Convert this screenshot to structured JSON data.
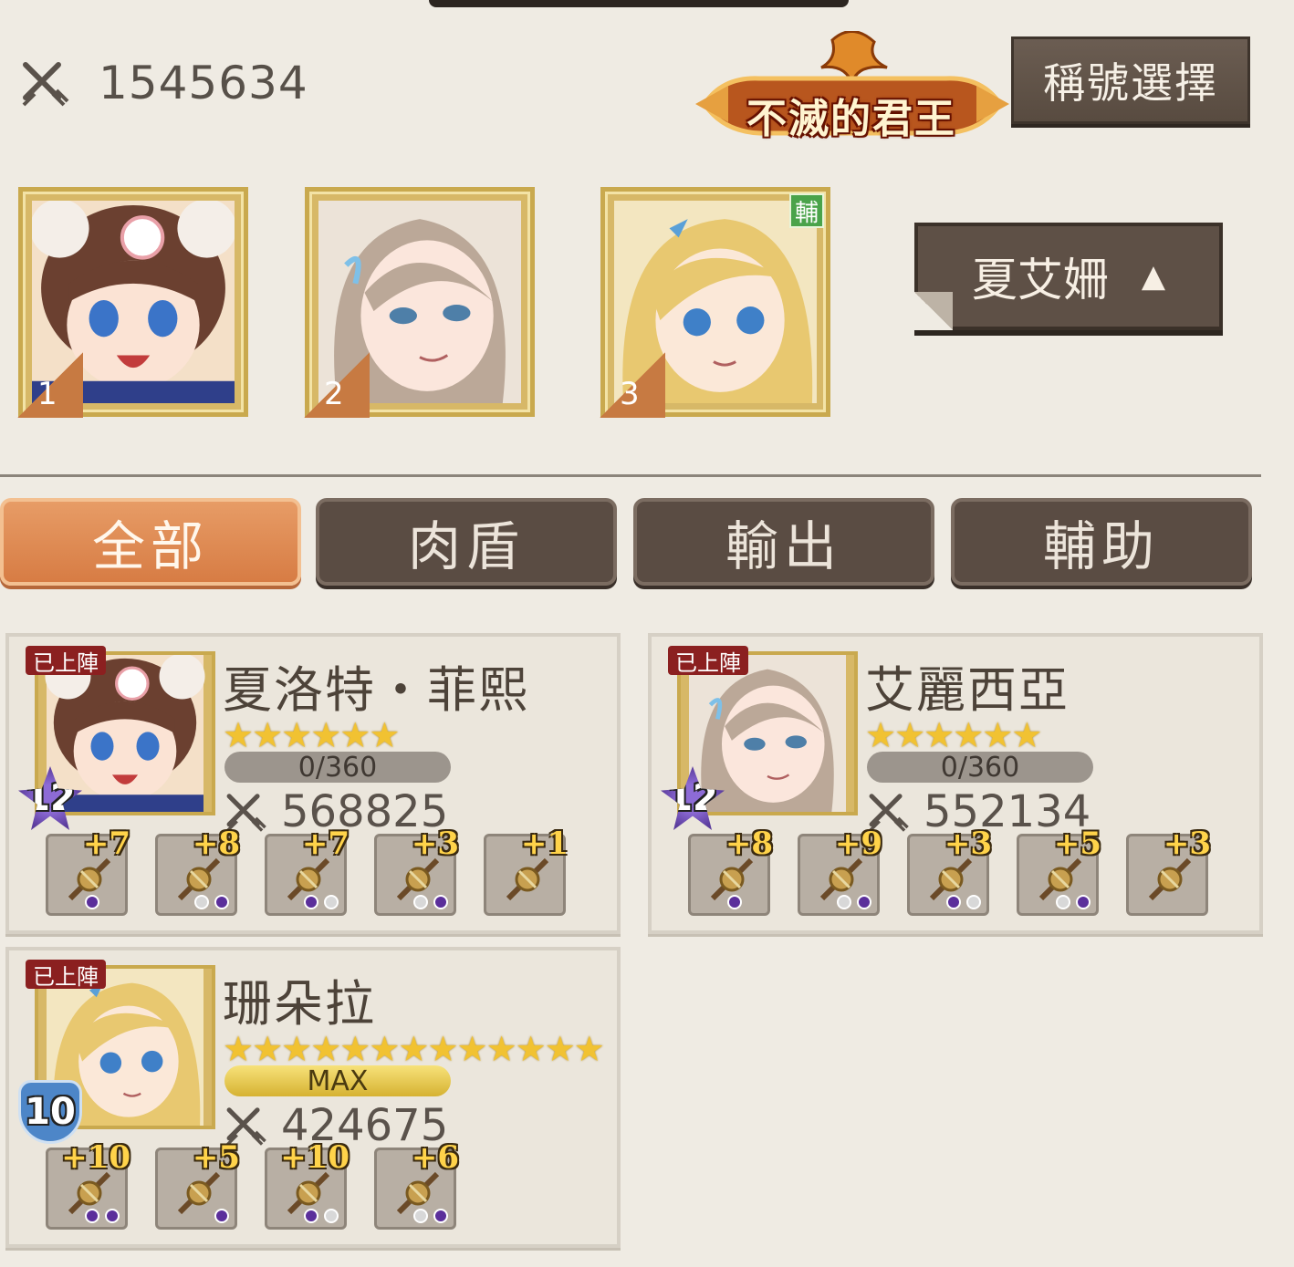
{
  "header": {
    "total_power": "1545634",
    "title_badge": "不滅的君王",
    "title_select_label": "稱號選擇"
  },
  "team": {
    "slots": [
      {
        "number": "1",
        "support": ""
      },
      {
        "number": "2",
        "support": ""
      },
      {
        "number": "3",
        "support": "輔"
      }
    ],
    "leader_select": {
      "name": "夏艾姍",
      "arrow": "▲"
    }
  },
  "tabs": [
    {
      "label": "全部",
      "active": true
    },
    {
      "label": "肉盾",
      "active": false
    },
    {
      "label": "輸出",
      "active": false
    },
    {
      "label": "輔助",
      "active": false
    }
  ],
  "heroes": [
    {
      "deployed_label": "已上陣",
      "name": "夏洛特・菲熙",
      "stars": "★★★★★★",
      "exp": "0/360",
      "level": "12",
      "power": "568825",
      "equipment": [
        "+7",
        "+8",
        "+7",
        "+3",
        "+1"
      ]
    },
    {
      "deployed_label": "已上陣",
      "name": "艾麗西亞",
      "stars": "★★★★★★",
      "exp": "0/360",
      "level": "12",
      "power": "552134",
      "equipment": [
        "+8",
        "+9",
        "+3",
        "+5",
        "+3"
      ]
    },
    {
      "deployed_label": "已上陣",
      "name": "珊朵拉",
      "stars": "★★★★★★★★★★★★★",
      "exp": "MAX",
      "level": "10",
      "power": "424675",
      "equipment": [
        "+10",
        "+5",
        "+10",
        "+6"
      ]
    }
  ],
  "colors": {
    "background": "#efebe3",
    "tab_active": "#d77c44",
    "tab_inactive": "#5a4c43",
    "gold_frame": "#c9a94e"
  }
}
